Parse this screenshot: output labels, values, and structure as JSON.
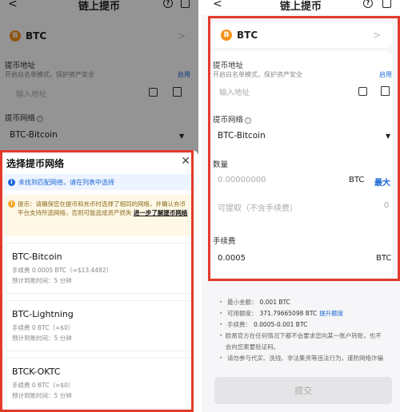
{
  "left": {
    "header": {
      "back": "<",
      "title": "链上提币",
      "help": "?"
    },
    "coin": {
      "symbol": "BTC",
      "icon_letter": "B",
      "chevron": ">"
    },
    "address": {
      "label": "提币地址",
      "whitelist_text": "开启白名单模式，保护资产安全",
      "enable": "启用",
      "placeholder": "输入地址"
    },
    "network": {
      "label": "提币网络",
      "info": "i",
      "value": "BTC-Bitcoin",
      "caret": "▼"
    },
    "sheet": {
      "title": "选择提币网络",
      "close": "✕",
      "blue_notice": "未找到匹配网络，请在列表中选择",
      "blue_icon": "i",
      "yellow_icon": "!",
      "yellow_notice": "提示：请确保您在提币和充币时选择了相同的网络，并确认充币平台支持所选网络，否则可能造成资产损失",
      "yellow_link": "进一步了解提币网络",
      "networks": [
        {
          "name": "BTC-Bitcoin",
          "fee": "手续费 0.0005 BTC（≈$13.4482）",
          "eta": "预计到账时间：5 分钟"
        },
        {
          "name": "BTC-Lightning",
          "fee": "手续费 0 BTC（≈$0）",
          "eta": "预计到账时间：5 分钟"
        },
        {
          "name": "BTCK-OKTC",
          "fee": "手续费 0 BTC（≈$0）",
          "eta": "预计到账时间：5 分钟"
        }
      ]
    }
  },
  "right": {
    "header": {
      "back": "<",
      "title": "链上提币",
      "help": "?"
    },
    "coin": {
      "symbol": "BTC",
      "icon_letter": "B",
      "chevron": ">"
    },
    "address": {
      "label": "提币地址",
      "whitelist_text": "开启白名单模式，保护资产安全",
      "enable": "启用",
      "placeholder": "输入地址"
    },
    "network": {
      "label": "提币网络",
      "info": "i",
      "value": "BTC-Bitcoin",
      "caret": "▼"
    },
    "amount": {
      "label": "数量",
      "placeholder": "0.00000000",
      "unit": "BTC",
      "max": "最大",
      "available_label": "可提取（不含手续费）",
      "available_value": "0"
    },
    "fee": {
      "label": "手续费",
      "value": "0.0005",
      "unit": "BTC"
    },
    "info": {
      "min_label": "最小金额：",
      "min_value": "0.001 BTC",
      "quota_label": "可用额度：",
      "quota_value": "371.79665098 BTC",
      "quota_link": "提升额度",
      "fee_label": "手续费：",
      "fee_value": "0.0005-0.001 BTC",
      "warn1": "欧易官方在任何情况下都不会要求您向某一账户转账，也不会向您索要验证码。",
      "warn2": "请勿参与代买、洗钱、非法集资等违法行为，谨防网络诈骗"
    },
    "submit": "提交"
  }
}
